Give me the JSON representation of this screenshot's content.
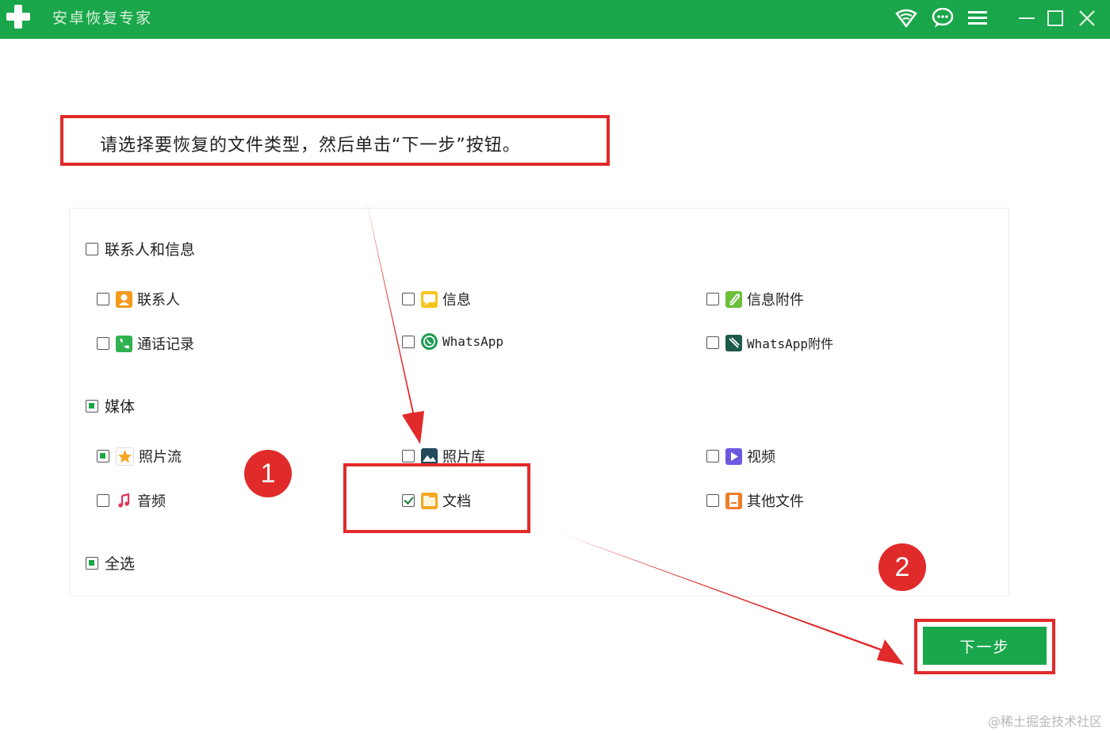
{
  "app": {
    "title": "安卓恢复专家"
  },
  "instruction": "请选择要恢复的文件类型，然后单击“下一步”按钮。",
  "groups": {
    "contacts_messages": {
      "label": "联系人和信息",
      "items": {
        "contacts": "联系人",
        "messages": "信息",
        "message_attachments": "信息附件",
        "call_logs": "通话记录",
        "whatsapp": "WhatsApp",
        "whatsapp_attachments": "WhatsApp附件"
      }
    },
    "media": {
      "label": "媒体",
      "items": {
        "photo_stream": "照片流",
        "photo_library": "照片库",
        "videos": "视频",
        "audio": "音频",
        "documents": "文档",
        "other_files": "其他文件"
      }
    },
    "select_all": "全选"
  },
  "next_button": "下一步",
  "annotations": {
    "step1": "1",
    "step2": "2"
  },
  "watermark": "@稀土掘金技术社区",
  "colors": {
    "brand_green": "#1aa64a",
    "annotation_red": "#e12a2a"
  }
}
